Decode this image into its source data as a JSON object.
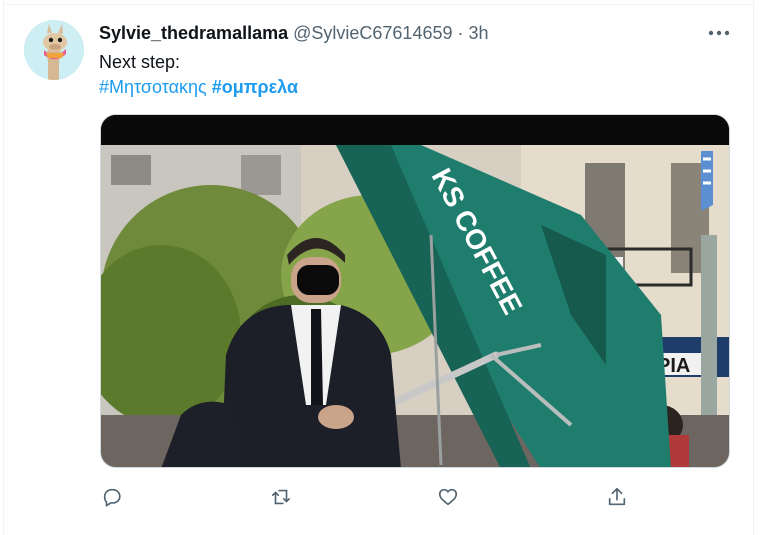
{
  "tweet": {
    "author_name": "Sylvie_thedramallama",
    "handle": "@SylvieC67614659",
    "separator": "·",
    "time": "3h",
    "line1": "Next step:",
    "hashtags": [
      {
        "text": "#Μητσοτακης",
        "bold": false
      },
      {
        "text": "#ομπρελα",
        "bold": true
      }
    ]
  },
  "media": {
    "umbrella_text": "KS COFFEE",
    "shop_sign_text": "PIA",
    "description_icon": "photo"
  },
  "actions": [
    {
      "name": "reply-button",
      "icon": "reply-icon"
    },
    {
      "name": "retweet-button",
      "icon": "retweet-icon"
    },
    {
      "name": "like-button",
      "icon": "heart-icon"
    },
    {
      "name": "share-button",
      "icon": "share-icon"
    }
  ],
  "colors": {
    "text": "#0f1419",
    "secondary": "#536471",
    "link": "#1d9bf0",
    "border": "#eff3f4",
    "umbrella_green": "#1f7d6e"
  }
}
